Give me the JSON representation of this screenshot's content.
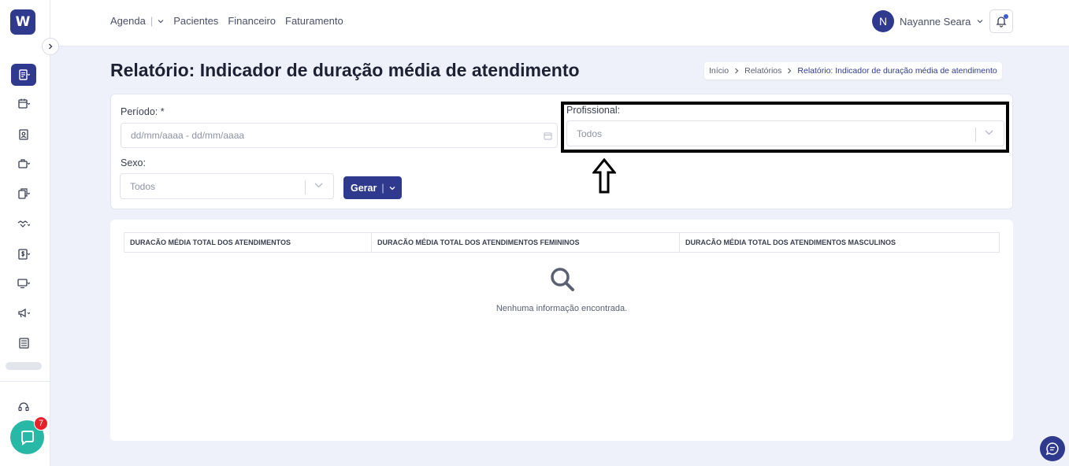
{
  "app": {
    "logo_letter": "W"
  },
  "sidebar": {
    "items": [
      {
        "icon": "report-icon",
        "active": true
      },
      {
        "icon": "calendar-icon"
      },
      {
        "icon": "patient-badge-icon"
      },
      {
        "icon": "briefcase-icon"
      },
      {
        "icon": "documents-icon"
      },
      {
        "icon": "handshake-icon"
      },
      {
        "icon": "dollar-icon"
      },
      {
        "icon": "monitor-icon"
      },
      {
        "icon": "megaphone-icon"
      },
      {
        "icon": "newspaper-icon"
      },
      {
        "icon": "headset-icon"
      }
    ],
    "chat_badge": "7"
  },
  "topbar": {
    "nav": [
      "Agenda",
      "Pacientes",
      "Financeiro",
      "Faturamento"
    ],
    "nav_pipe": "|",
    "user_initial": "N",
    "user_name": "Nayanne Seara"
  },
  "page": {
    "title": "Relatório: Indicador de duração média de atendimento",
    "breadcrumb": [
      "Início",
      "Relatórios",
      "Relatório: Indicador de duração média de atendimento"
    ]
  },
  "filters": {
    "periodo_label": "Período: *",
    "periodo_placeholder": "dd/mm/aaaa - dd/mm/aaaa",
    "profissional_label": "Profissional:",
    "profissional_value": "Todos",
    "sexo_label": "Sexo:",
    "sexo_value": "Todos",
    "gerar_label": "Gerar",
    "gerar_pipe": "|"
  },
  "table": {
    "columns": [
      "DURACÃO MÉDIA TOTAL DOS ATENDIMENTOS",
      "DURACÃO MÉDIA TOTAL DOS ATENDIMENTOS FEMININOS",
      "DURACÃO MÉDIA TOTAL DOS ATENDIMENTOS MASCULINOS"
    ],
    "empty_message": "Nenhuma informação encontrada."
  },
  "colors": {
    "primary": "#2f3a8f",
    "chat": "#28b8a6",
    "badge": "#e8202a",
    "background": "#eff1fa"
  }
}
